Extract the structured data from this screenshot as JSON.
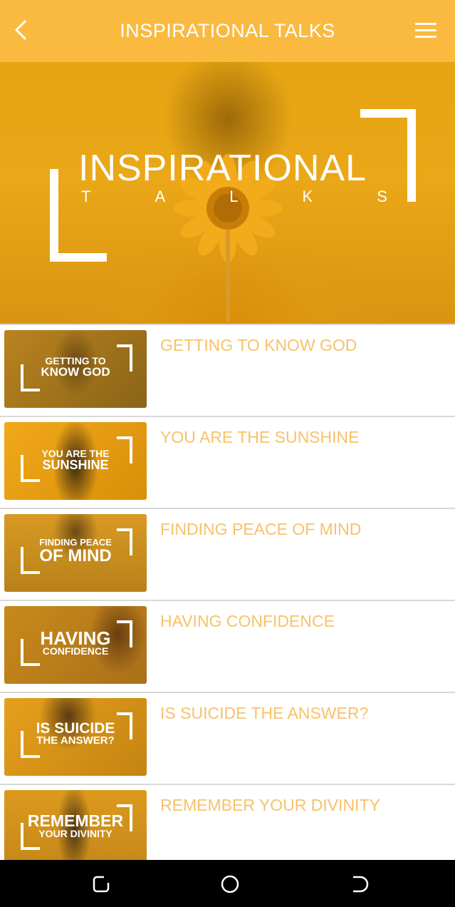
{
  "header": {
    "title": "INSPIRATIONAL TALKS",
    "back_icon": "chevron-left-icon",
    "menu_icon": "hamburger-menu-icon",
    "color": "#f9ba3f"
  },
  "hero": {
    "line1": "INSPIRATIONAL",
    "line2": [
      "T",
      "A",
      "L",
      "K",
      "S"
    ]
  },
  "talks": [
    {
      "title": "GETTING TO KNOW GOD",
      "thumb_top": "GETTING TO",
      "thumb_bottom": "KNOW GOD"
    },
    {
      "title": "YOU ARE THE SUNSHINE",
      "thumb_top": "YOU ARE THE",
      "thumb_bottom": "SUNSHINE"
    },
    {
      "title": "FINDING PEACE OF MIND",
      "thumb_top": "FINDING PEACE",
      "thumb_bottom": "OF MIND"
    },
    {
      "title": "HAVING CONFIDENCE",
      "thumb_top": "HAVING",
      "thumb_bottom": "CONFIDENCE"
    },
    {
      "title": "IS SUICIDE THE ANSWER?",
      "thumb_top": "IS SUICIDE",
      "thumb_bottom": "THE ANSWER?"
    },
    {
      "title": "REMEMBER YOUR DIVINITY",
      "thumb_top": "REMEMBER",
      "thumb_bottom": "YOUR DIVINITY"
    }
  ],
  "colors": {
    "accent": "#f9ba3f",
    "title_text": "#f7c26a",
    "thumb_bg": "#e19a12"
  },
  "system_nav": {
    "icons": [
      "recent-apps-icon",
      "home-icon",
      "back-icon"
    ]
  }
}
